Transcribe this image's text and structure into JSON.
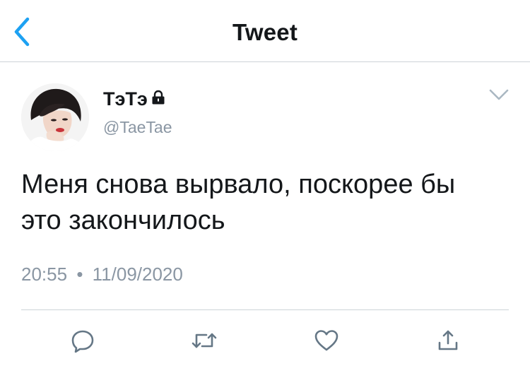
{
  "header": {
    "title": "Tweet",
    "back_icon": "chevron-left-icon"
  },
  "author": {
    "display_name": "TэTэ",
    "handle": "@TaeTae",
    "protected_icon": "lock-icon",
    "avatar": "avatar-photo"
  },
  "tweet": {
    "text_line1": "Меня снова вырвало, поскорее бы",
    "text_line2": "это закончилось",
    "time": "20:55",
    "separator": "•",
    "date": "11/09/2020"
  },
  "actions": [
    "reply-icon",
    "retweet-icon",
    "like-icon",
    "share-icon"
  ],
  "colors": {
    "accent": "#1da1f2",
    "muted": "#8a96a3",
    "text": "#14171a",
    "divider": "#cdd3d8"
  }
}
